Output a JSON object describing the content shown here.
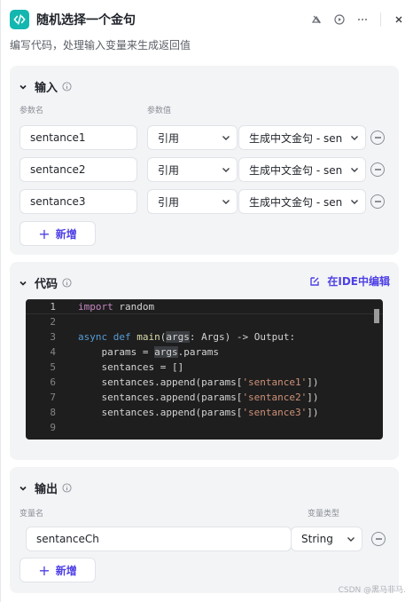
{
  "header": {
    "title": "随机选择一个金句",
    "description": "编写代码，处理输入变量来生成返回值"
  },
  "input": {
    "title": "输入",
    "col_name": "参数名",
    "col_value": "参数值",
    "rows": [
      {
        "name": "sentance1",
        "ref": "引用",
        "value": "生成中文金句 - sen"
      },
      {
        "name": "sentance2",
        "ref": "引用",
        "value": "生成中文金句 - sen"
      },
      {
        "name": "sentance3",
        "ref": "引用",
        "value": "生成中文金句 - sen"
      }
    ],
    "add_label": "新增"
  },
  "code": {
    "title": "代码",
    "ide_label": "在IDE中编辑",
    "line_numbers": [
      "1",
      "2",
      "3",
      "4",
      "5",
      "6",
      "7",
      "8",
      "9"
    ]
  },
  "output": {
    "title": "输出",
    "col_name": "变量名",
    "col_type": "变量类型",
    "rows": [
      {
        "name": "sentanceCh",
        "type": "String"
      }
    ],
    "add_label": "新增"
  },
  "watermark": "CSDN @黑马非马."
}
